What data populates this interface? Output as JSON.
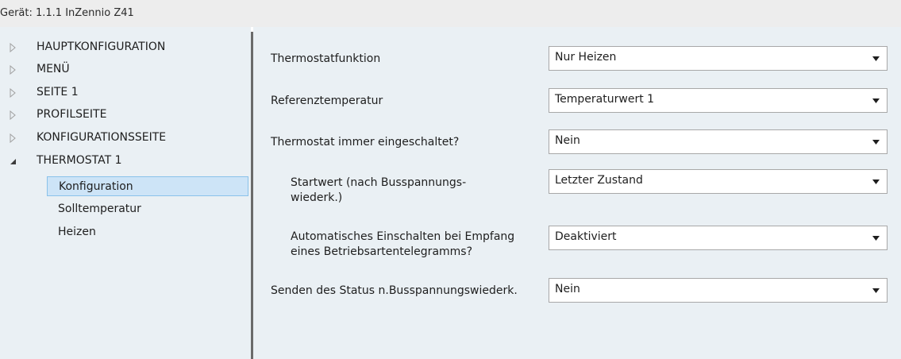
{
  "header": {
    "device_title": "Gerät: 1.1.1  InZennio Z41"
  },
  "tree": {
    "items": [
      {
        "label": "HAUPTKONFIGURATION",
        "expanded": false
      },
      {
        "label": "MENÜ",
        "expanded": false
      },
      {
        "label": "SEITE 1",
        "expanded": false
      },
      {
        "label": "PROFILSEITE",
        "expanded": false
      },
      {
        "label": "KONFIGURATIONSSEITE",
        "expanded": false
      },
      {
        "label": "THERMOSTAT 1",
        "expanded": true
      }
    ],
    "children": [
      {
        "label": "Konfiguration",
        "selected": true
      },
      {
        "label": "Solltemperatur",
        "selected": false
      },
      {
        "label": "Heizen",
        "selected": false
      }
    ]
  },
  "settings": {
    "rows": [
      {
        "label": "Thermostatfunktion",
        "value": "Nur Heizen"
      },
      {
        "label": "Referenztemperatur",
        "value": "Temperaturwert 1"
      },
      {
        "label": "Thermostat immer eingeschaltet?",
        "value": "Nein"
      },
      {
        "label_line1": "Startwert (nach Busspannungs-",
        "label_line2": "wiederk.)",
        "value": "Letzter Zustand"
      },
      {
        "label_line1": "Automatisches Einschalten bei Empfang",
        "label_line2": "eines Betriebsartentelegramms?",
        "value": "Deaktiviert"
      },
      {
        "label": "Senden des Status n.Busspannungswiederk.",
        "value": "Nein"
      }
    ]
  },
  "colors": {
    "panel_bg": "#eaf0f4",
    "selection_bg": "#cde4f7",
    "selection_border": "#8ac2ea",
    "splitter": "#6a6a6a"
  },
  "icons": {
    "collapsed": "triangle-right-outline",
    "expanded": "triangle-down-filled",
    "dropdown": "caret-down"
  }
}
